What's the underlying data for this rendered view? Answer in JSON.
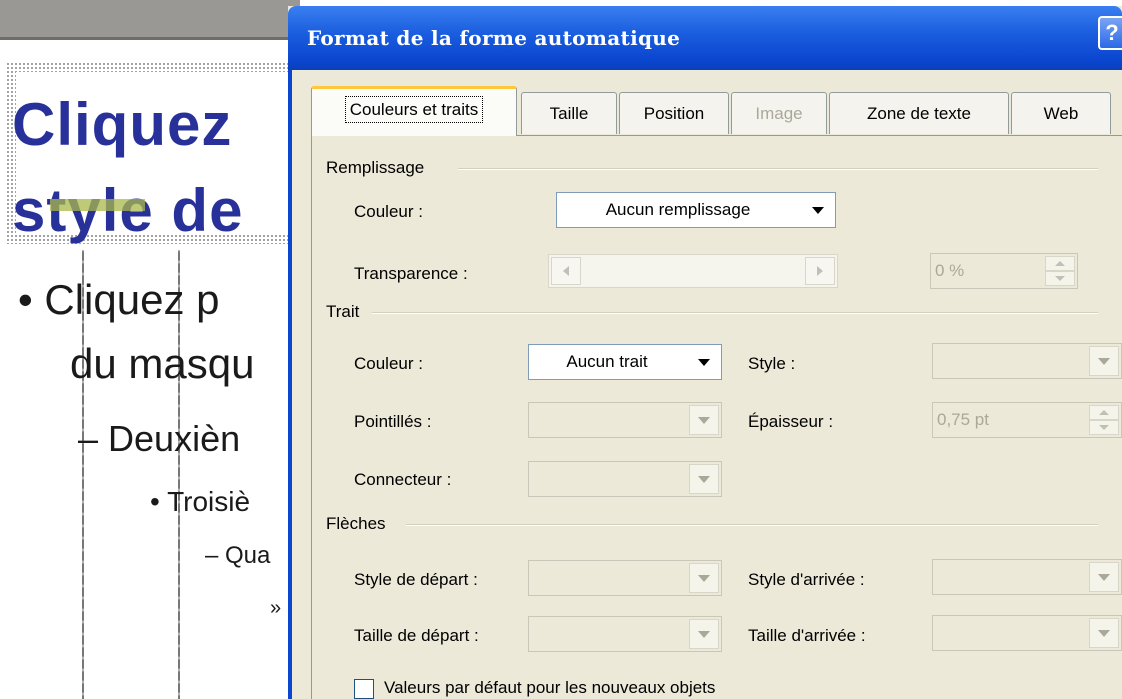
{
  "slide": {
    "title_line1": "Cliquez",
    "title_line2": "style de",
    "bullet1": "• Cliquez p",
    "bullet1_cont": "du masqu",
    "bullet2": "– Deuxièn",
    "bullet3": "• Troisiè",
    "bullet4": "– Qua",
    "bullet5": "»"
  },
  "dialog": {
    "title": "Format de la forme automatique",
    "help_label": "?",
    "tabs": [
      {
        "label": "Couleurs et traits",
        "active": true,
        "disabled": false
      },
      {
        "label": "Taille",
        "active": false,
        "disabled": false
      },
      {
        "label": "Position",
        "active": false,
        "disabled": false
      },
      {
        "label": "Image",
        "active": false,
        "disabled": true
      },
      {
        "label": "Zone de texte",
        "active": false,
        "disabled": false
      },
      {
        "label": "Web",
        "active": false,
        "disabled": false
      }
    ],
    "fill": {
      "group_label": "Remplissage",
      "color_label": "Couleur :",
      "color_value": "Aucun remplissage",
      "transparency_label": "Transparence :",
      "transparency_value": "0 %"
    },
    "line": {
      "group_label": "Trait",
      "color_label": "Couleur :",
      "color_value": "Aucun trait",
      "style_label": "Style :",
      "dashed_label": "Pointillés :",
      "weight_label": "Épaisseur :",
      "weight_value": "0,75 pt",
      "connector_label": "Connecteur :"
    },
    "arrows": {
      "group_label": "Flèches",
      "begin_style_label": "Style de départ :",
      "end_style_label": "Style d'arrivée :",
      "begin_size_label": "Taille de départ :",
      "end_size_label": "Taille d'arrivée :"
    },
    "defaults_checkbox_label": "Valeurs par défaut pour les nouveaux objets"
  },
  "colors": {
    "titlebar_blue": "#0a46cf",
    "slide_title_color": "#28309a",
    "dialog_bg": "#ece9d8",
    "active_tab_accent": "#ffc83c"
  }
}
